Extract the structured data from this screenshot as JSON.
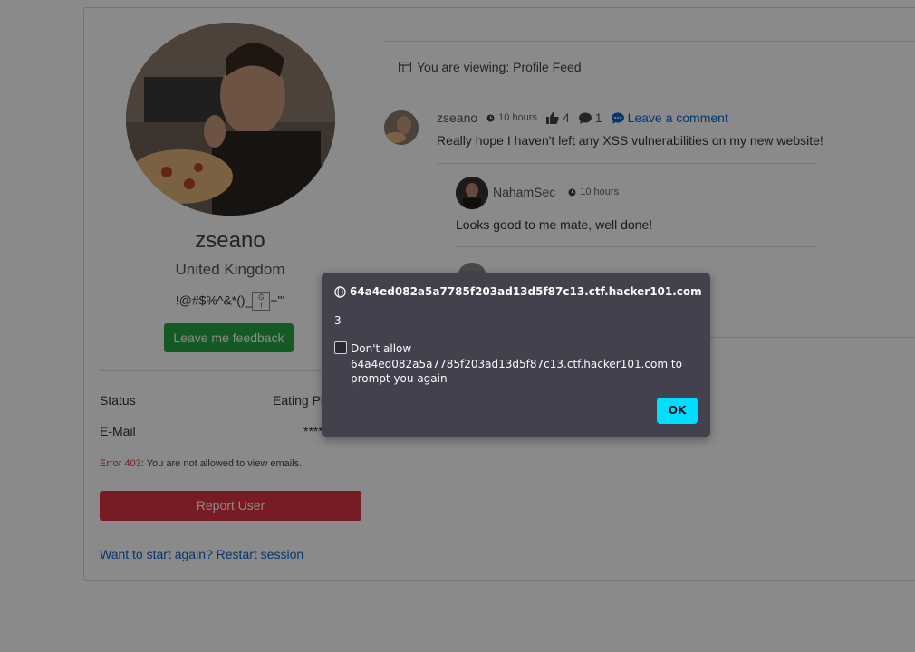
{
  "profile": {
    "username": "zseano",
    "country": "United Kingdom",
    "bio_prefix": "!@#$%^&*()_",
    "bio_suffix": "+\"'",
    "bio_glyph": "Ğ\nİ",
    "feedback_label": "Leave me feedback",
    "status_label": "Status",
    "status_value": "Eating Pi",
    "email_label": "E-Mail",
    "email_value": "****",
    "error_code": "Error 403",
    "error_text": ": You are not allowed to view emails.",
    "report_label": "Report User",
    "restart_label": "Want to start again? Restart session"
  },
  "feed": {
    "heading": "You are viewing: Profile Feed",
    "post": {
      "author": "zseano",
      "time": "10 hours",
      "likes": "4",
      "comments": "1",
      "comment_link": "Leave a comment",
      "text": "Really hope I haven't left any XSS vulnerabilities on my new website!"
    },
    "reply": {
      "author": "NahamSec",
      "time": "10 hours",
      "text": "Looks good to me mate, well done!"
    }
  },
  "dialog": {
    "origin": "64a4ed082a5a7785f203ad13d5f87c13.ctf.hacker101.com",
    "message": "3",
    "checkbox_label": "Don't allow 64a4ed082a5a7785f203ad13d5f87c13.ctf.hacker101.com to prompt you again",
    "ok_label": "OK"
  },
  "colors": {
    "success": "#28a745",
    "danger": "#dc3545",
    "link": "#0b63ce",
    "dialog_bg": "#42414d",
    "ok_button": "#00ddff"
  }
}
